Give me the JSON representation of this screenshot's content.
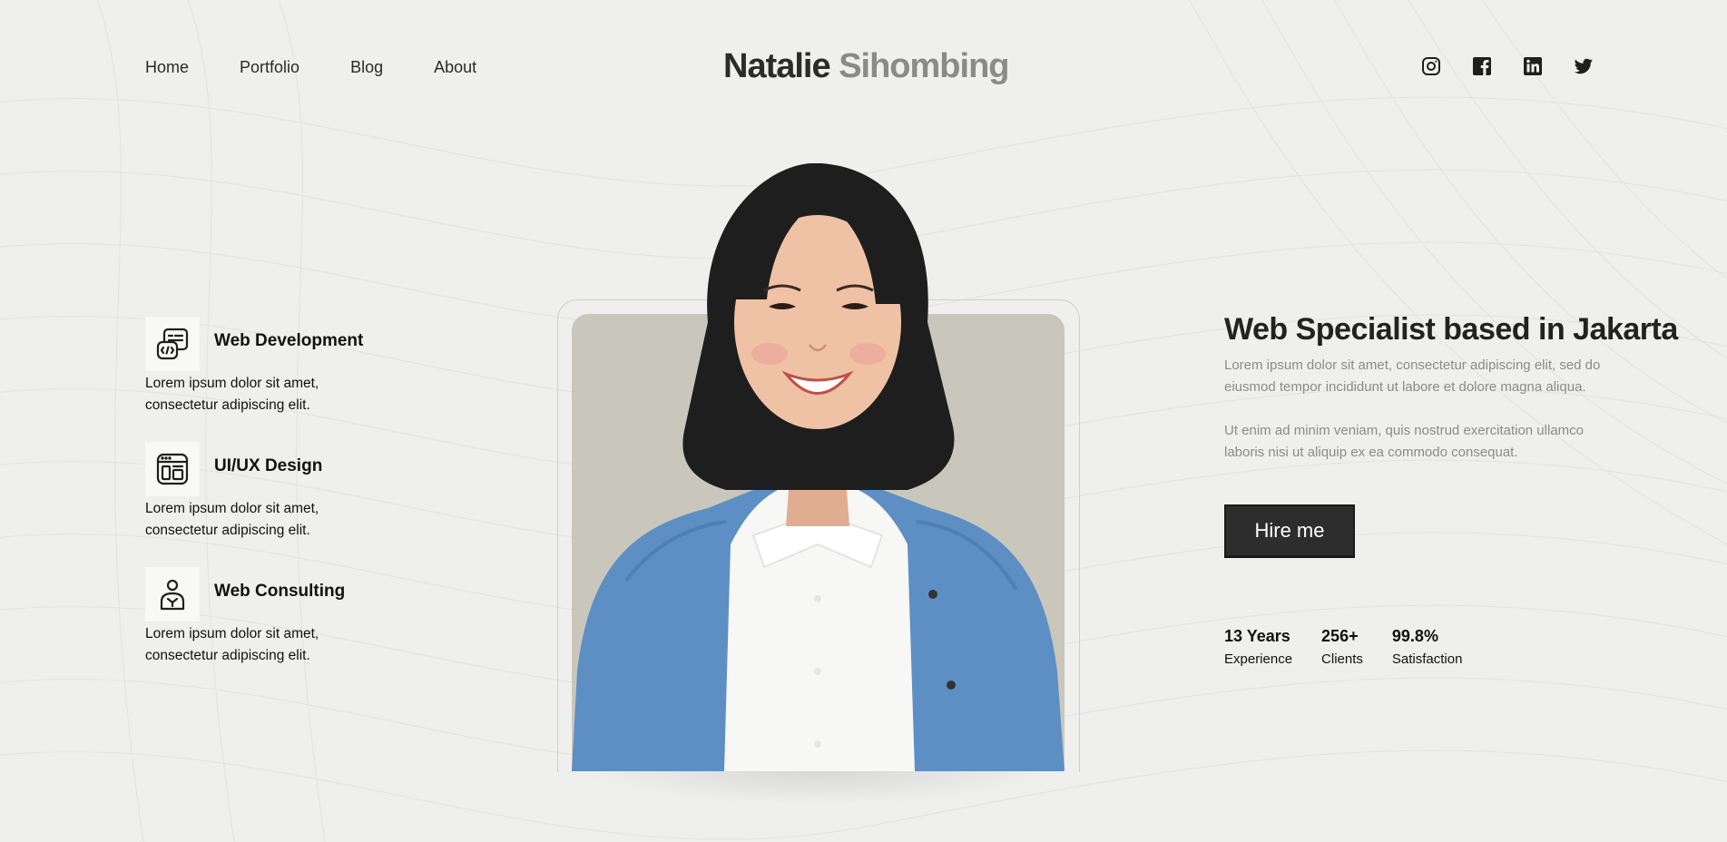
{
  "nav": {
    "items": [
      "Home",
      "Portfolio",
      "Blog",
      "About"
    ]
  },
  "logo": {
    "first": "Natalie",
    "last": "Sihombing"
  },
  "social": {
    "icons": [
      "instagram-icon",
      "facebook-icon",
      "linkedin-icon",
      "twitter-icon"
    ]
  },
  "services": [
    {
      "title": "Web Development",
      "description": "Lorem ipsum dolor sit amet, consectetur adipiscing elit.",
      "icon": "code-window-icon"
    },
    {
      "title": "UI/UX Design",
      "description": "Lorem ipsum dolor sit amet, consectetur adipiscing elit.",
      "icon": "layout-grid-icon"
    },
    {
      "title": "Web Consulting",
      "description": "Lorem ipsum dolor sit amet, consectetur adipiscing elit.",
      "icon": "consultant-icon"
    }
  ],
  "hero": {
    "title": "Web Specialist based in Jakarta",
    "paragraph1": "Lorem ipsum dolor sit amet, consectetur adipiscing elit, sed do eiusmod tempor incididunt ut labore et dolore magna aliqua.",
    "paragraph2": "Ut enim ad minim veniam, quis nostrud exercitation ullamco laboris nisi ut aliquip ex ea commodo consequat.",
    "cta_label": "Hire me"
  },
  "stats": [
    {
      "value": "13 Years",
      "label": "Experience"
    },
    {
      "value": "256+",
      "label": "Clients"
    },
    {
      "value": "99.8%",
      "label": "Satisfaction"
    }
  ],
  "colors": {
    "background": "#efefed",
    "accent_dark": "#2d2d2d",
    "muted_text": "#8b8b8b",
    "photo_bg": "#c9c7bc",
    "cardigan": "#5d8fc4"
  }
}
